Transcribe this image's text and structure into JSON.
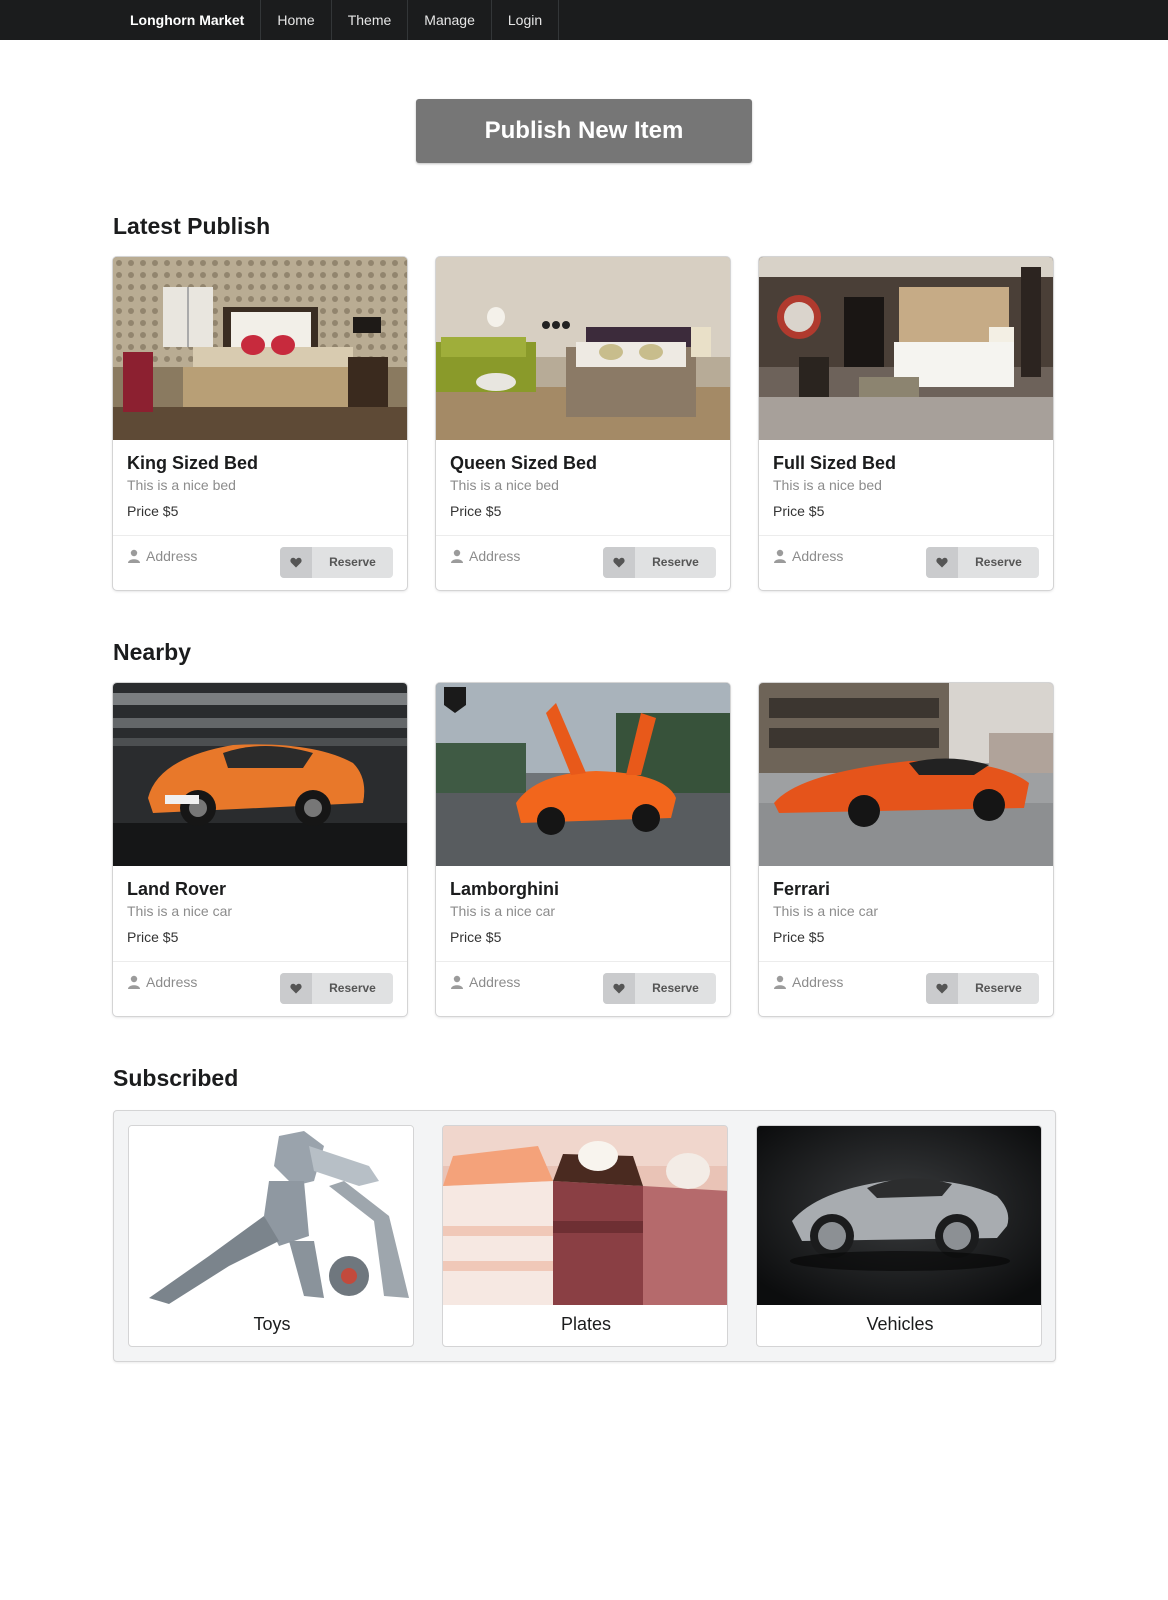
{
  "nav": {
    "brand": "Longhorn Market",
    "items": [
      {
        "label": "Home"
      },
      {
        "label": "Theme"
      },
      {
        "label": "Manage"
      },
      {
        "label": "Login"
      }
    ]
  },
  "publish_label": "Publish New Item",
  "sections": {
    "latest": {
      "title": "Latest Publish",
      "cards": [
        {
          "title": "King Sized Bed",
          "desc": "This is a nice bed",
          "price": "Price $5",
          "address": "Address",
          "reserve": "Reserve"
        },
        {
          "title": "Queen Sized Bed",
          "desc": "This is a nice bed",
          "price": "Price $5",
          "address": "Address",
          "reserve": "Reserve"
        },
        {
          "title": "Full Sized Bed",
          "desc": "This is a nice bed",
          "price": "Price $5",
          "address": "Address",
          "reserve": "Reserve"
        }
      ]
    },
    "nearby": {
      "title": "Nearby",
      "cards": [
        {
          "title": "Land Rover",
          "desc": "This is a nice car",
          "price": "Price $5",
          "address": "Address",
          "reserve": "Reserve"
        },
        {
          "title": "Lamborghini",
          "desc": "This is a nice car",
          "price": "Price $5",
          "address": "Address",
          "reserve": "Reserve"
        },
        {
          "title": "Ferrari",
          "desc": "This is a nice car",
          "price": "Price $5",
          "address": "Address",
          "reserve": "Reserve"
        }
      ]
    },
    "subscribed": {
      "title": "Subscribed",
      "items": [
        {
          "label": "Toys"
        },
        {
          "label": "Plates"
        },
        {
          "label": "Vehicles"
        }
      ]
    }
  },
  "icons": {
    "address": "user-icon",
    "reserve": "heart-icon"
  },
  "colors": {
    "navbar": "#1b1c1d",
    "publish_button": "#767676",
    "reserve_button": "#e0e1e2"
  }
}
